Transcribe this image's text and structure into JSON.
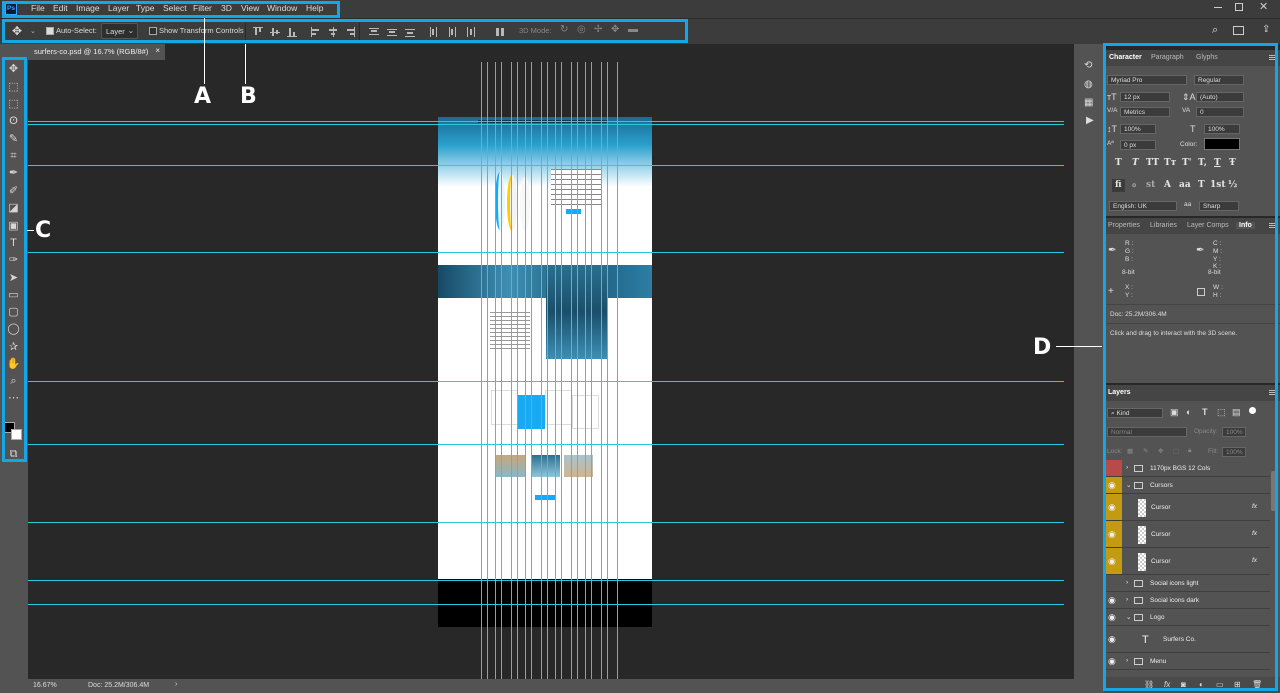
{
  "app": {
    "logo": "Ps"
  },
  "menu": [
    "File",
    "Edit",
    "Image",
    "Layer",
    "Type",
    "Select",
    "Filter",
    "3D",
    "View",
    "Window",
    "Help"
  ],
  "options": {
    "auto_select_label": "Auto-Select:",
    "auto_select_value": "Layer",
    "show_transform_label": "Show Transform Controls",
    "mode_3d_label": "3D Mode:"
  },
  "document": {
    "tab_title": "surfers-co.psd @ 16.7% (RGB/8#)",
    "close": "×"
  },
  "status": {
    "zoom": "16.67%",
    "doc": "Doc: 25.2M/306.4M",
    "arrow": "›"
  },
  "callouts": {
    "a": "A",
    "b": "B",
    "c": "C",
    "d": "D"
  },
  "character": {
    "tabs": [
      "Character",
      "Paragraph",
      "Glyphs"
    ],
    "font": "Myriad Pro",
    "style": "Regular",
    "size": "12 px",
    "leading": "(Auto)",
    "kerning": "Metrics",
    "tracking": "0",
    "vscale": "100%",
    "hscale": "100%",
    "baseline": "0 px",
    "color_label": "Color:",
    "type_buttons": [
      "T",
      "T",
      "TT",
      "Tт",
      "T'",
      "T,",
      "T",
      "Ŧ"
    ],
    "opentype_buttons": [
      "fi",
      "ℴ",
      "st",
      "A",
      "aa",
      "T",
      "1st",
      "½"
    ],
    "language": "English: UK",
    "antialias": "Sharp"
  },
  "info": {
    "tabs": [
      "Properties",
      "Libraries",
      "Layer Comps",
      "Info"
    ],
    "rgb": [
      "R :",
      "G :",
      "B :"
    ],
    "cmyk": [
      "C :",
      "M :",
      "Y :",
      "K :"
    ],
    "bit1": "8-bit",
    "bit2": "8-bit",
    "xy": [
      "X :",
      "Y :"
    ],
    "wh": [
      "W :",
      "H :"
    ],
    "doc": "Doc: 25.2M/306.4M",
    "hint": "Click and drag to interact with the 3D scene."
  },
  "layers": {
    "tab": "Layers",
    "filter": "Kind",
    "blend": "Normal",
    "opacity_label": "Opacity:",
    "opacity": "100%",
    "lock_label": "Lock:",
    "fill_label": "Fill:",
    "fill": "100%",
    "items": [
      {
        "name": "1170px BGS 12 Cols",
        "type": "folder",
        "eye": "red"
      },
      {
        "name": "Cursors",
        "type": "folder-open",
        "eye": "yellow"
      },
      {
        "name": "Cursor",
        "type": "layer",
        "eye": "yellow",
        "fx": "fx"
      },
      {
        "name": "Cursor",
        "type": "layer",
        "eye": "yellow",
        "fx": "fx"
      },
      {
        "name": "Cursor",
        "type": "layer",
        "eye": "yellow",
        "fx": "fx"
      },
      {
        "name": "Social icons light",
        "type": "folder",
        "eye": "none"
      },
      {
        "name": "Social icons dark",
        "type": "folder",
        "eye": "on"
      },
      {
        "name": "Logo",
        "type": "folder-open",
        "eye": "on"
      },
      {
        "name": "Surfers Co.",
        "type": "text",
        "eye": "on"
      },
      {
        "name": "Menu",
        "type": "folder",
        "eye": "on"
      }
    ]
  },
  "colors": {
    "highlight": "#15a6e8",
    "guide": "#2ec9d8",
    "panel": "#535353",
    "workspace": "#282828"
  }
}
